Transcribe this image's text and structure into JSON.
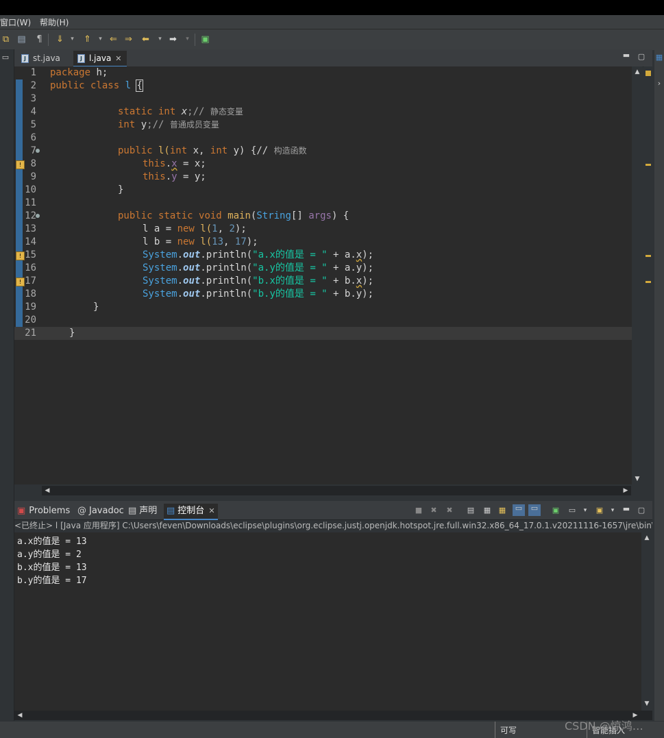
{
  "menu": {
    "window": "窗口(W)",
    "help": "帮助(H)"
  },
  "editor": {
    "tabs": [
      {
        "label": "st.java"
      },
      {
        "label": "l.java"
      }
    ],
    "lines": [
      {
        "n": "1"
      },
      {
        "n": "2"
      },
      {
        "n": "3"
      },
      {
        "n": "4"
      },
      {
        "n": "5"
      },
      {
        "n": "6"
      },
      {
        "n": "7"
      },
      {
        "n": "8"
      },
      {
        "n": "9"
      },
      {
        "n": "10"
      },
      {
        "n": "11"
      },
      {
        "n": "12"
      },
      {
        "n": "13"
      },
      {
        "n": "14"
      },
      {
        "n": "15"
      },
      {
        "n": "16"
      },
      {
        "n": "17"
      },
      {
        "n": "18"
      },
      {
        "n": "19"
      },
      {
        "n": "20"
      },
      {
        "n": "21"
      }
    ],
    "code": {
      "l1a": "package",
      "l1b": " h;",
      "l2a": "public",
      "l2b": " class",
      "l2c": " l ",
      "l2d": "{",
      "l4a": "static",
      "l4b": " int",
      "l4c": " x",
      "l4d": ";// ",
      "l4e": "静态变量",
      "l5a": "int",
      "l5b": " y",
      "l5c": ";// ",
      "l5d": "普通成员变量",
      "l7a": "public",
      "l7b": " l(",
      "l7c": "int",
      "l7d": " x, ",
      "l7e": "int",
      "l7f": " y) {// ",
      "l7g": "构造函数",
      "l8a": "this",
      "l8b": ".",
      "l8c": "x",
      "l8d": " = x;",
      "l9a": "this",
      "l9b": ".",
      "l9c": "y",
      "l9d": " = y;",
      "l10": "}",
      "l12a": "public",
      "l12b": " static",
      "l12c": " void",
      "l12d": " main",
      "l12e": "(",
      "l12f": "String",
      "l12g": "[] ",
      "l12h": "args",
      "l12i": ") {",
      "l13a": "l a = ",
      "l13b": "new",
      "l13c": " l(",
      "l13d": "1",
      "l13e": ", ",
      "l13f": "2",
      "l13g": ");",
      "l14a": "l b = ",
      "l14b": "new",
      "l14c": " l(",
      "l14d": "13",
      "l14e": ", ",
      "l14f": "17",
      "l14g": ");",
      "sys": "System",
      "dot": ".",
      "out": "out",
      "println": ".println(",
      "s15": "\"a.x的值是 = \"",
      "t15a": " + a.",
      "t15b": "x",
      "t15c": ");",
      "s16": "\"a.y的值是 = \"",
      "t16a": " + a.y);",
      "s17": "\"b.x的值是 = \"",
      "t17a": " + b.",
      "t17b": "x",
      "t17c": ");",
      "s18": "\"b.y的值是 = \"",
      "t18a": " + b.y);",
      "l19": "}",
      "l21": "}"
    }
  },
  "console": {
    "tabs": [
      {
        "label": "Problems"
      },
      {
        "label": "Javadoc"
      },
      {
        "label": "声明"
      },
      {
        "label": "控制台"
      }
    ],
    "terminated": "<已终止> l [Java 应用程序] C:\\Users\\feven\\Downloads\\eclipse\\plugins\\org.eclipse.justj.openjdk.hotspot.jre.full.win32.x86_64_17.0.1.v20211116-1657\\jre\\bin\\javaw.",
    "output": [
      "a.x的值是 = 13",
      "a.y的值是 = 2",
      "b.x的值是 = 13",
      "b.y的值是 = 17"
    ]
  },
  "status": {
    "writable": "可写",
    "insert": "智能插入"
  },
  "watermark": "CSDN @惊鸿…",
  "colors": {
    "keyword": "#cc7832",
    "string": "#17c6a3",
    "number": "#6897bb",
    "class": "#4aa3df",
    "field": "#9876aa"
  }
}
